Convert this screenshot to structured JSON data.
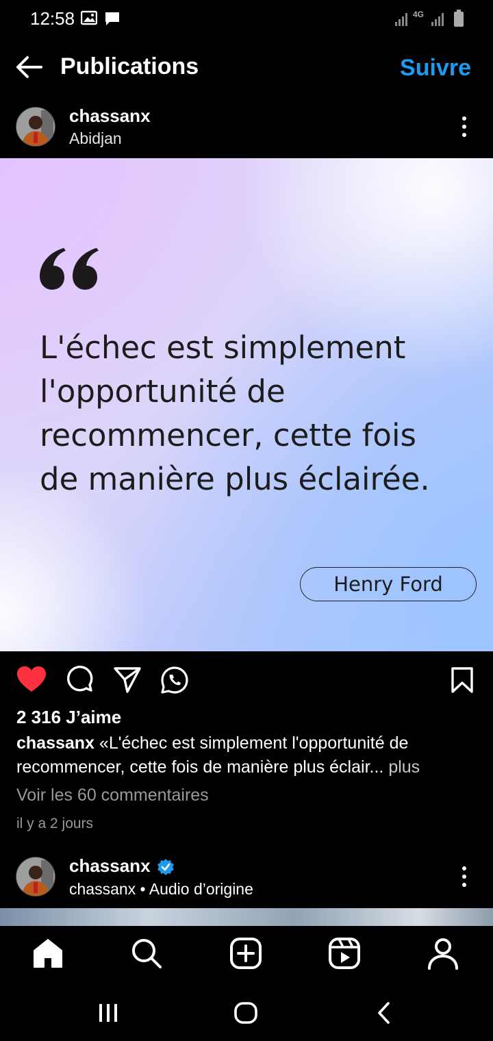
{
  "status_bar": {
    "time": "12:58",
    "network": "4G"
  },
  "header": {
    "title": "Publications",
    "follow_label": "Suivre"
  },
  "post": {
    "username": "chassanx",
    "location": "Abidjan",
    "quote": "L'échec est simplement l'opportunité de recommencer, cette fois de manière plus éclairée.",
    "author": "Henry Ford",
    "likes": "2 316 J’aime",
    "caption_user": "chassanx",
    "caption_text": "«L'échec est simplement l'opportunité de recommencer, cette fois de manière plus éclair...",
    "more_label": "plus",
    "comments_label": "Voir les 60 commentaires",
    "time_ago": "il y a 2 jours",
    "liked": true
  },
  "next_post": {
    "username": "chassanx",
    "verified": true,
    "subline": "chassanx • Audio d’origine"
  },
  "colors": {
    "accent": "#1d9bf0",
    "like": "#ff3040",
    "verified": "#1d9bf0"
  },
  "icons": [
    "back-arrow-icon",
    "gallery-icon",
    "message-icon",
    "signal-icon",
    "battery-icon",
    "more-vertical-icon",
    "heart-icon",
    "comment-icon",
    "share-icon",
    "whatsapp-icon",
    "bookmark-icon",
    "home-icon",
    "search-icon",
    "add-icon",
    "reels-icon",
    "profile-icon",
    "recents-icon",
    "home-circle-icon",
    "back-nav-icon",
    "verified-badge-icon"
  ]
}
